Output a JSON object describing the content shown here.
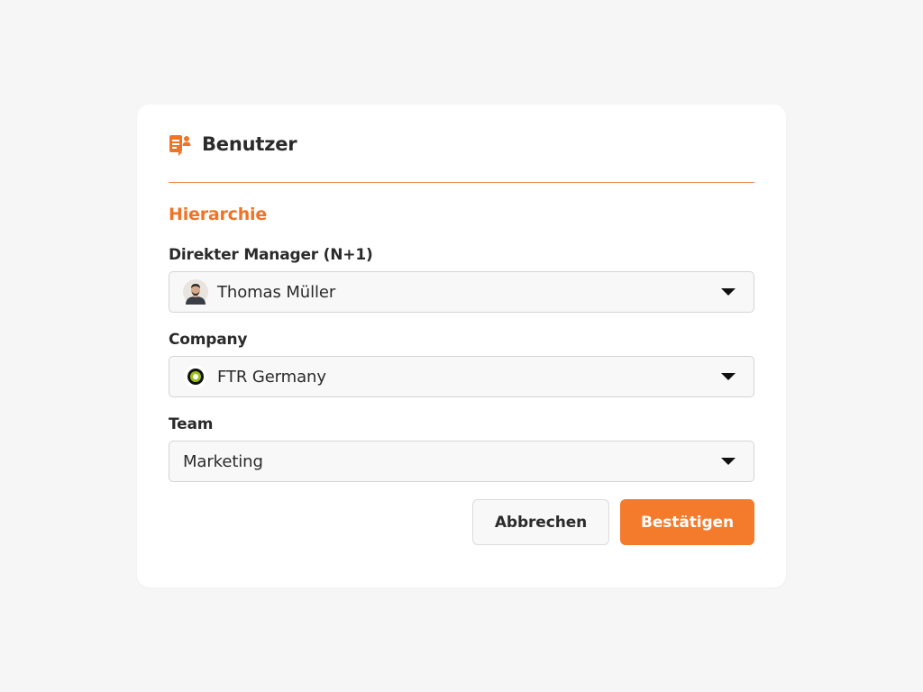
{
  "dialog": {
    "title": "Benutzer",
    "title_icon": "user-card-icon",
    "section_title": "Hierarchie"
  },
  "fields": {
    "manager": {
      "label": "Direkter Manager (N+1)",
      "value": "Thomas Müller",
      "icon": "avatar"
    },
    "company": {
      "label": "Company",
      "value": "FTR Germany",
      "icon": "company-logo"
    },
    "team": {
      "label": "Team",
      "value": "Marketing"
    }
  },
  "actions": {
    "cancel_label": "Abbrechen",
    "confirm_label": "Bestätigen"
  },
  "colors": {
    "accent": "#f47a2c",
    "background": "#f6f6f6",
    "card": "#ffffff",
    "text": "#2b2b2b"
  }
}
